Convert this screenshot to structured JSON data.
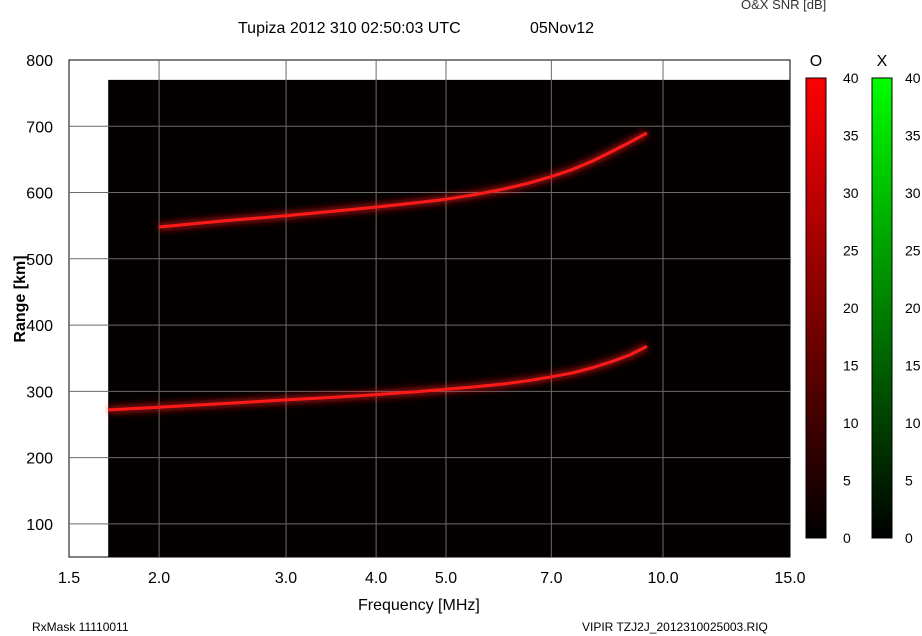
{
  "header": {
    "title": "Tupiza 2012 310 02:50:03 UTC",
    "date": "05Nov12",
    "snr_label": "O&X SNR [dB]"
  },
  "footer": {
    "left": "RxMask 11110011",
    "right": "VIPIR  TZJ2J_2012310025003.RIQ"
  },
  "chart_data": {
    "type": "heatmap",
    "title": "Tupiza 2012 310 02:50:03 UTC",
    "xlabel": "Frequency [MHz]",
    "ylabel": "Range [km]",
    "x_scale": "log",
    "xlim": [
      1.5,
      15.0
    ],
    "ylim": [
      50,
      800
    ],
    "data_xlim": [
      1.7,
      15.0
    ],
    "data_ylim": [
      50,
      770
    ],
    "x_ticks": [
      1.5,
      2.0,
      3.0,
      4.0,
      5.0,
      7.0,
      10.0,
      15.0
    ],
    "x_tick_labels": [
      "1.5",
      "2.0",
      "3.0",
      "4.0",
      "5.0",
      "7.0",
      "10.0",
      "15.0"
    ],
    "y_ticks": [
      100,
      200,
      300,
      400,
      500,
      600,
      700,
      800
    ],
    "y_tick_labels": [
      "100",
      "200",
      "300",
      "400",
      "500",
      "600",
      "700",
      "800"
    ],
    "grid": true,
    "traces": [
      {
        "name": "O",
        "color": "#ff1a1a",
        "x": [
          1.7,
          2.0,
          2.5,
          3.0,
          3.5,
          4.0,
          4.5,
          5.0,
          5.5,
          6.0,
          6.5,
          7.0,
          7.5,
          8.0,
          8.5,
          9.0,
          9.5
        ],
        "y": [
          272,
          276,
          282,
          287,
          291,
          295,
          299,
          303,
          307,
          311,
          316,
          322,
          328,
          336,
          345,
          355,
          368
        ]
      },
      {
        "name": "O",
        "color": "#ff1a1a",
        "x": [
          2.0,
          2.5,
          3.0,
          3.5,
          4.0,
          4.5,
          5.0,
          5.5,
          6.0,
          6.5,
          7.0,
          7.5,
          8.0,
          8.5,
          9.0,
          9.5
        ],
        "y": [
          548,
          558,
          565,
          572,
          578,
          584,
          590,
          597,
          605,
          614,
          624,
          635,
          648,
          662,
          676,
          690
        ]
      }
    ],
    "colorbars": [
      {
        "name": "O",
        "range": [
          0,
          40
        ],
        "colors": [
          "#000000",
          "#ff0000"
        ],
        "ticks": [
          0,
          5,
          10,
          15,
          20,
          25,
          30,
          35,
          40
        ]
      },
      {
        "name": "X",
        "range": [
          0,
          40
        ],
        "colors": [
          "#000000",
          "#00ff00"
        ],
        "ticks": [
          0,
          5,
          10,
          15,
          20,
          25,
          30,
          35,
          40
        ]
      }
    ],
    "colorbar_label": "O&X SNR [dB]"
  }
}
